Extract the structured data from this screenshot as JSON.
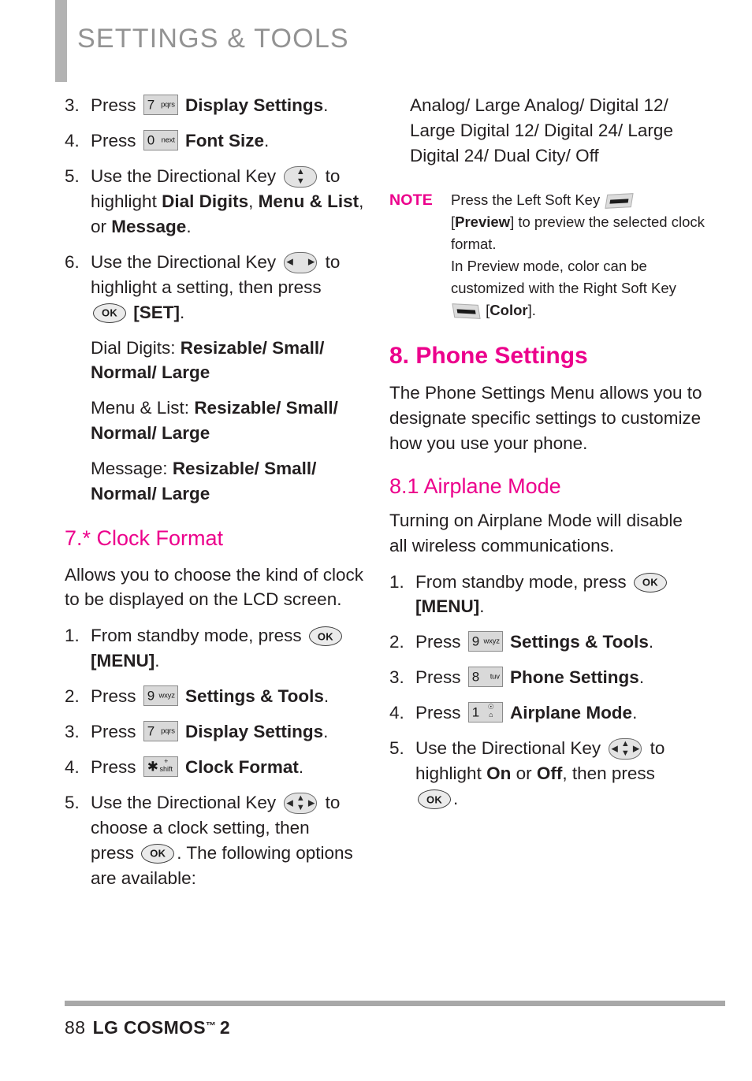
{
  "header": {
    "title": "SETTINGS & TOOLS"
  },
  "left_column": {
    "steps_font_size": [
      {
        "num": "3.",
        "press_label": "Press",
        "key": {
          "digit": "7",
          "label": "pqrs"
        },
        "target": "Display Settings",
        "period": "."
      },
      {
        "num": "4.",
        "press_label": "Press",
        "key": {
          "digit": "0",
          "label": "next"
        },
        "target": "Font Size",
        "period": "."
      }
    ],
    "step5": {
      "num": "5.",
      "text_before": "Use the Directional Key",
      "text_after": "to",
      "line2_before": "highlight ",
      "bold1": "Dial Digits",
      "sep1": ", ",
      "bold2": "Menu & List",
      "sep2": ", or ",
      "bold3": "Message",
      "end": "."
    },
    "step6": {
      "num": "6.",
      "text_before": "Use the Directional Key",
      "text_after": "to",
      "line2": "highlight a setting, then press",
      "bracket": "[SET]",
      "end": "."
    },
    "options": [
      {
        "label": "Dial Digits: ",
        "values": "Resizable/ Small/ Normal/ Large"
      },
      {
        "label": "Menu & List: ",
        "values": "Resizable/ Small/ Normal/ Large"
      },
      {
        "label": "Message: ",
        "values": "Resizable/ Small/ Normal/ Large"
      }
    ],
    "clock_format": {
      "heading": "7.* Clock Format",
      "intro": "Allows you to choose the kind of clock to be displayed on the LCD screen.",
      "step1": {
        "num": "1.",
        "text": "From standby mode, press",
        "bracket": "[MENU]",
        "end": "."
      },
      "steps": [
        {
          "num": "2.",
          "press_label": "Press",
          "key": {
            "digit": "9",
            "label": "wxyz"
          },
          "target": "Settings & Tools",
          "period": "."
        },
        {
          "num": "3.",
          "press_label": "Press",
          "key": {
            "digit": "7",
            "label": "pqrs"
          },
          "target": "Display Settings",
          "period": "."
        },
        {
          "num": "4.",
          "press_label": "Press",
          "key": {
            "digit": "✱",
            "label_top": "+",
            "label_bottom": "shift"
          },
          "target": "Clock Format",
          "period": "."
        }
      ],
      "step5": {
        "num": "5.",
        "text_before": "Use the Directional Key",
        "text_after": "to",
        "line2": "choose a clock setting, then",
        "line3_before": "press",
        "line3_after": ". The following options",
        "line4": "are available:"
      }
    }
  },
  "right_column": {
    "clock_options": "Analog/ Large Analog/ Digital 12/ Large Digital 12/ Digital 24/ Large Digital 24/ Dual City/ Off",
    "note": {
      "label": "NOTE",
      "line1_before": "Press the Left Soft Key",
      "line2_bracket_open": "[",
      "line2_bold": "Preview",
      "line2_bracket_close": "]",
      "line2_after": " to preview the selected clock format.",
      "line3": "In Preview mode, color can be customized with the Right Soft Key",
      "line4_bracket_open": "[",
      "line4_bold": "Color",
      "line4_bracket_close": "]",
      "line4_end": "."
    },
    "phone_settings": {
      "heading": "8. Phone Settings",
      "intro": "The Phone Settings Menu allows you to designate specific settings to customize how you use your phone."
    },
    "airplane_mode": {
      "heading": "8.1 Airplane Mode",
      "intro": "Turning on Airplane Mode will disable all wireless communications.",
      "step1": {
        "num": "1.",
        "text": "From standby mode, press",
        "bracket": "[MENU]",
        "end": "."
      },
      "steps": [
        {
          "num": "2.",
          "press_label": "Press",
          "key": {
            "digit": "9",
            "label": "wxyz"
          },
          "target": "Settings & Tools",
          "period": "."
        },
        {
          "num": "3.",
          "press_label": "Press",
          "key": {
            "digit": "8",
            "label": "tuv"
          },
          "target": "Phone Settings",
          "period": "."
        },
        {
          "num": "4.",
          "press_label": "Press",
          "key": {
            "digit": "1",
            "label_top": "☉",
            "label_bottom": "⌂"
          },
          "target": "Airplane Mode",
          "period": "."
        }
      ],
      "step5": {
        "num": "5.",
        "text_before": "Use the Directional Key",
        "text_after": "to",
        "line2_before": "highlight ",
        "bold1": "On",
        "sep1": " or ",
        "bold2": "Off",
        "sep2": ", then press",
        "end": "."
      }
    }
  },
  "footer": {
    "page_number": "88",
    "brand": "LG COSMOS",
    "tm": "™",
    "model": "2"
  },
  "colors": {
    "magenta": "#ec008c",
    "header_gray": "#939393",
    "bar_gray": "#b3b3b3",
    "rule_gray": "#a8a8a8"
  }
}
